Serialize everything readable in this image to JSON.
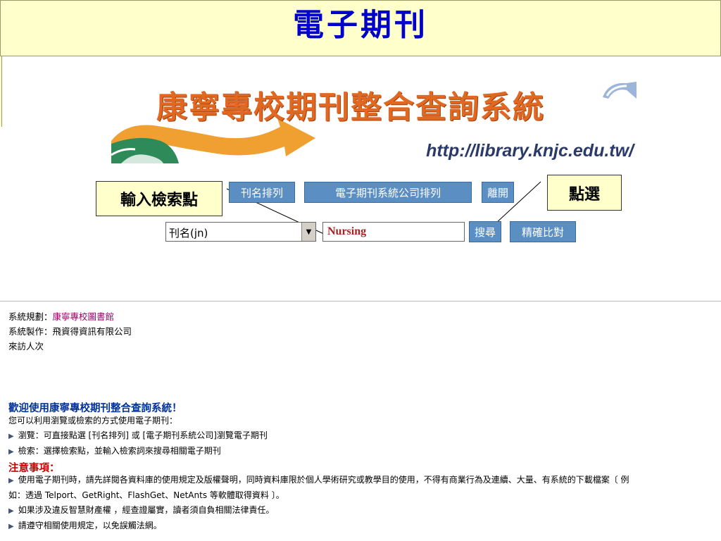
{
  "slide": {
    "title": "電子期刊"
  },
  "banner": {
    "title": "康寧專校期刊整合查詢系統",
    "url": "http://library.knjc.edu.tw/"
  },
  "callouts": {
    "left": "輸入檢索點",
    "right": "點選"
  },
  "nav_buttons": {
    "title_sort": "刊名排列",
    "vendor_sort": "電子期刊系統公司排列",
    "exit": "離開"
  },
  "search": {
    "field_select": "刊名(jn)",
    "query": "Nursing",
    "search_button": "搜尋",
    "exact_button": "精確比對"
  },
  "credits": {
    "planning_label": "系統規劃：",
    "planning_value": "康寧專校圖書館",
    "maker": "系統製作：飛資得資訊有限公司",
    "visitors": "來訪人次"
  },
  "welcome": {
    "title": "歡迎使用康寧專校期刊整合查詢系統！",
    "intro": "您可以利用瀏覽或檢索的方式使用電子期刊：",
    "bullets": [
      "瀏覽：可直接點選 [刊名排列] 或 [電子期刊系統公司]瀏覽電子期刊",
      "檢索：選擇檢索點，並輸入檢索詞來搜尋相關電子期刊"
    ]
  },
  "notice": {
    "title": "注意事項：",
    "line1": "使用電子期刊時，請先詳閱各資料庫的使用規定及版權聲明，同時資料庫限於個人學術研究或教學目的使用，不得有商業行為及連續、大量、有系統的下載檔案〔 例",
    "line1_cont": "如：透過 Telport、GetRight、FlashGet、NetAnts 等軟體取得資料 〕。",
    "line2": "如果涉及違反智慧財產權 ，經查證屬實，讀者須自負相關法律責任。",
    "line3": "請遵守相關使用規定，以免誤觸法網。"
  }
}
